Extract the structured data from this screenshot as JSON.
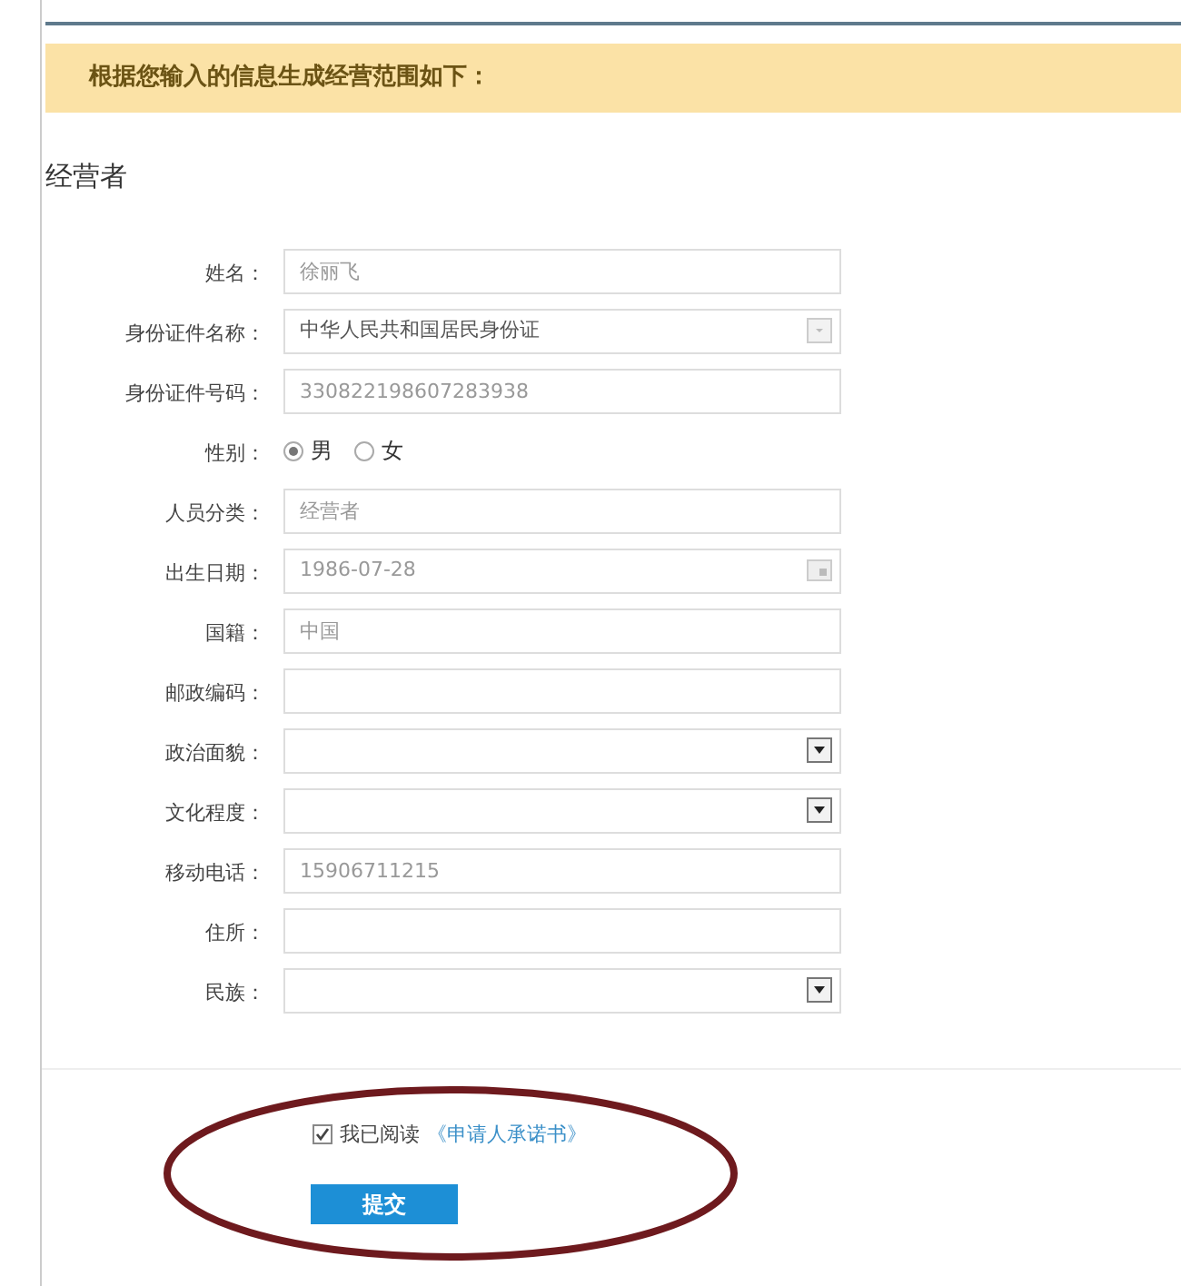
{
  "banner": "根据您输入的信息生成经营范围如下：",
  "section_title": "经营者",
  "fields": [
    {
      "label": "姓名：",
      "kind": "text",
      "value": "徐丽飞"
    },
    {
      "label": "身份证件名称：",
      "kind": "select",
      "value": "中华人民共和国居民身份证"
    },
    {
      "label": "身份证件号码：",
      "kind": "text",
      "value": "330822198607283938"
    },
    {
      "label": "性别：",
      "kind": "radio",
      "options": [
        {
          "label": "男",
          "selected": true
        },
        {
          "label": "女",
          "selected": false
        }
      ]
    },
    {
      "label": "人员分类：",
      "kind": "text",
      "value": "经营者"
    },
    {
      "label": "出生日期：",
      "kind": "date",
      "value": "1986-07-28"
    },
    {
      "label": "国籍：",
      "kind": "text",
      "value": "中国"
    },
    {
      "label": "邮政编码：",
      "kind": "text"
    },
    {
      "label": "政治面貌：",
      "kind": "select"
    },
    {
      "label": "文化程度：",
      "kind": "select"
    },
    {
      "label": "移动电话：",
      "kind": "text",
      "value": "15906711215"
    },
    {
      "label": "住所：",
      "kind": "text"
    },
    {
      "label": "民族：",
      "kind": "select"
    }
  ],
  "agreement": {
    "checked": true,
    "text": "我已阅读",
    "link": "《申请人承诺书》"
  },
  "submit": "提交"
}
